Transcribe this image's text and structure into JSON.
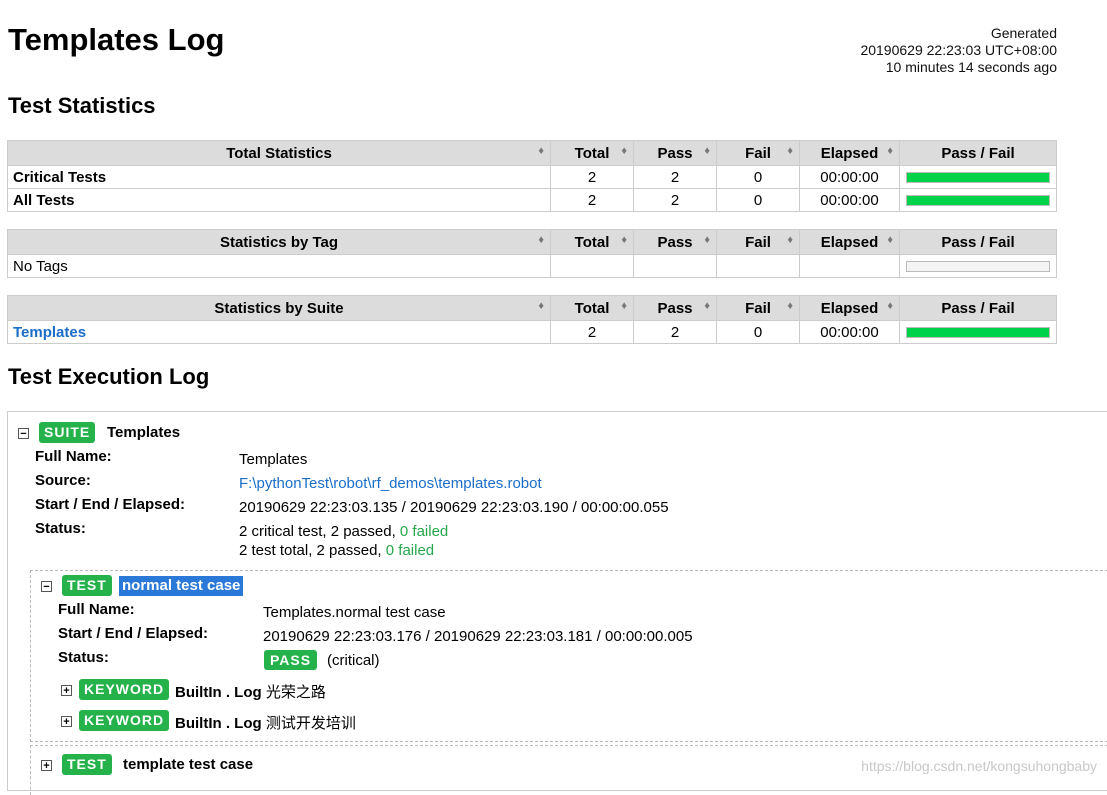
{
  "header": {
    "title": "Templates Log",
    "generated_label": "Generated",
    "generated_time": "20190629 22:23:03 UTC+08:00",
    "generated_ago": "10 minutes 14 seconds ago"
  },
  "sections": {
    "test_statistics": "Test Statistics",
    "test_execution_log": "Test Execution Log"
  },
  "columns": [
    "Total",
    "Pass",
    "Fail",
    "Elapsed",
    "Pass / Fail"
  ],
  "total_statistics": {
    "header": "Total Statistics",
    "rows": [
      {
        "label": "Critical Tests",
        "total": "2",
        "pass": "2",
        "fail": "0",
        "elapsed": "00:00:00",
        "pass_ratio": 1.0
      },
      {
        "label": "All Tests",
        "total": "2",
        "pass": "2",
        "fail": "0",
        "elapsed": "00:00:00",
        "pass_ratio": 1.0
      }
    ]
  },
  "tag_statistics": {
    "header": "Statistics by Tag",
    "rows": [
      {
        "label": "No Tags",
        "total": "",
        "pass": "",
        "fail": "",
        "elapsed": "",
        "pass_ratio": 0
      }
    ]
  },
  "suite_statistics": {
    "header": "Statistics by Suite",
    "rows": [
      {
        "label": "Templates",
        "total": "2",
        "pass": "2",
        "fail": "0",
        "elapsed": "00:00:00",
        "pass_ratio": 1.0
      }
    ]
  },
  "suite": {
    "toggle": "−",
    "badge": "SUITE",
    "name": "Templates",
    "meta": {
      "full_name_label": "Full Name:",
      "full_name": "Templates",
      "source_label": "Source:",
      "source": "F:\\pythonTest\\robot\\rf_demos\\templates.robot",
      "times_label": "Start / End / Elapsed:",
      "times": "20190629 22:23:03.135 / 20190629 22:23:03.190 / 00:00:00.055",
      "status_label": "Status:",
      "status_line1_prefix": "2 critical test, 2 passed, ",
      "status_line1_failed": "0 failed",
      "status_line2_prefix": "2 test total, 2 passed, ",
      "status_line2_failed": "0 failed"
    }
  },
  "test1": {
    "toggle": "−",
    "badge": "TEST",
    "name": "normal test case",
    "meta": {
      "full_name_label": "Full Name:",
      "full_name": "Templates.normal test case",
      "times_label": "Start / End / Elapsed:",
      "times": "20190629 22:23:03.176 / 20190629 22:23:03.181 / 00:00:00.005",
      "status_label": "Status:",
      "status_badge": "PASS",
      "status_note": "(critical)"
    },
    "keywords": [
      {
        "toggle": "+",
        "badge": "KEYWORD",
        "name": "BuiltIn . Log",
        "arg": "光荣之路"
      },
      {
        "toggle": "+",
        "badge": "KEYWORD",
        "name": "BuiltIn . Log",
        "arg": "测试开发培训"
      }
    ]
  },
  "test2": {
    "toggle": "+",
    "badge": "TEST",
    "name": "template test case"
  },
  "watermark": "https://blog.csdn.net/kongsuhongbaby",
  "colors": {
    "pass_green": "#00d24a",
    "badge_green": "#26b24a",
    "link_blue": "#1a6ec8",
    "selected_blue": "#2a79d8"
  }
}
